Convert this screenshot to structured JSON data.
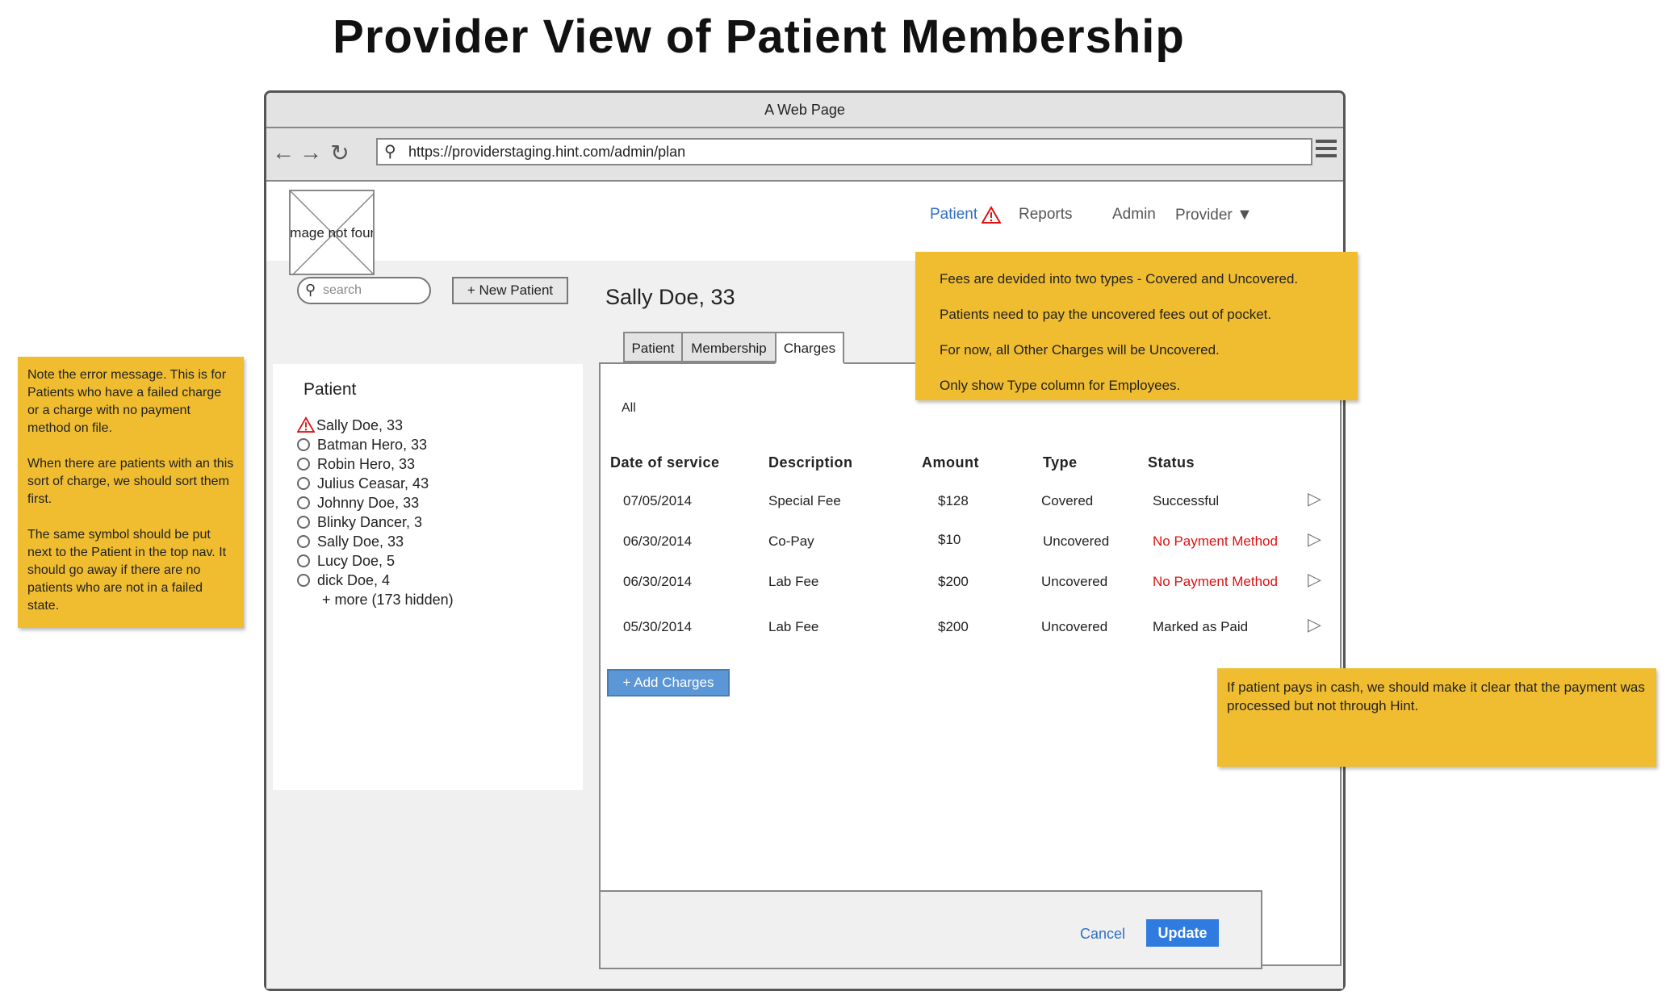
{
  "page_title": "Provider View of Patient Membership",
  "browser": {
    "window_title": "A Web Page",
    "url": "https://providerstaging.hint.com/admin/plan"
  },
  "logo": {
    "placeholder_text": "Image not found"
  },
  "top_nav": {
    "patient": "Patient",
    "reports": "Reports",
    "admin": "Admin",
    "provider": "Provider"
  },
  "search": {
    "placeholder": "search"
  },
  "new_patient_button": "+ New Patient",
  "patient_panel": {
    "title": "Patient",
    "items": [
      {
        "label": "Sally Doe, 33",
        "status": "warning"
      },
      {
        "label": "Batman Hero, 33",
        "status": "radio"
      },
      {
        "label": "Robin Hero, 33",
        "status": "radio"
      },
      {
        "label": "Julius Ceasar, 43",
        "status": "radio"
      },
      {
        "label": "Johnny Doe, 33",
        "status": "radio"
      },
      {
        "label": "Blinky Dancer, 3",
        "status": "radio"
      },
      {
        "label": "Sally Doe, 33",
        "status": "radio"
      },
      {
        "label": "Lucy Doe, 5",
        "status": "radio"
      },
      {
        "label": "dick Doe, 4",
        "status": "radio"
      }
    ],
    "more": "+ more (173 hidden)"
  },
  "selected_patient": "Sally Doe, 33",
  "tabs": [
    {
      "label": "Patient",
      "active": false
    },
    {
      "label": "Membership",
      "active": false
    },
    {
      "label": "Charges",
      "active": true
    }
  ],
  "charges": {
    "filter": "All",
    "columns": [
      "Date of service",
      "Description",
      "Amount",
      "Type",
      "Status"
    ],
    "rows": [
      {
        "date": "07/05/2014",
        "description": "Special Fee",
        "amount": "$128",
        "type": "Covered",
        "status": "Successful",
        "status_color": "#222222"
      },
      {
        "date": "06/30/2014",
        "description": "Co-Pay",
        "amount": "$10",
        "type": "Uncovered",
        "status": "No Payment Method",
        "status_color": "#dd1111"
      },
      {
        "date": "06/30/2014",
        "description": "Lab Fee",
        "amount": "$200",
        "type": "Uncovered",
        "status": "No Payment Method",
        "status_color": "#dd1111"
      },
      {
        "date": "05/30/2014",
        "description": "Lab Fee",
        "amount": "$200",
        "type": "Uncovered",
        "status": "Marked as Paid",
        "status_color": "#222222"
      }
    ],
    "add_button": "+ Add Charges"
  },
  "footer": {
    "cancel": "Cancel",
    "update": "Update"
  },
  "notes": {
    "left": [
      "Note the error message. This is for Patients who have a failed charge or a charge with no payment method on file.",
      "When there are patients with an this sort of charge, we should sort them first.",
      "The same symbol should be put next to the Patient in the top nav. It should go away if there are no patients who are not in a failed state."
    ],
    "top": [
      "Fees are devided into two types - Covered and Uncovered.",
      "Patients need to pay the uncovered fees out of pocket.",
      "For now, all Other Charges will be Uncovered.",
      "Only show Type column for Employees."
    ],
    "bottom": "If patient pays in cash, we should make it clear that the payment was processed but not through Hint."
  },
  "colors": {
    "note_yellow": "#f0bd31",
    "link_blue": "#2f6fc7",
    "error_red": "#dd1111",
    "primary_button": "#2f7be0"
  }
}
